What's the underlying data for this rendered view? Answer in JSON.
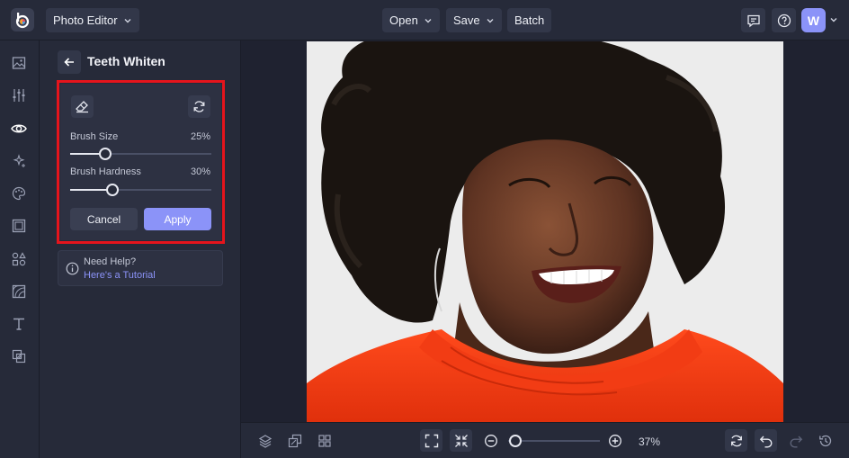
{
  "topbar": {
    "app_label": "Photo Editor",
    "open_label": "Open",
    "save_label": "Save",
    "batch_label": "Batch",
    "avatar_initial": "W"
  },
  "rail": {
    "icons": [
      "image-icon",
      "adjustments-icon",
      "eye-icon",
      "sparkle-icon",
      "palette-icon",
      "frame-icon",
      "shapes-icon",
      "texture-icon",
      "text-icon",
      "overlay-icon"
    ]
  },
  "panel": {
    "title": "Teeth Whiten",
    "brush_size_label": "Brush Size",
    "brush_size_value": "25%",
    "brush_size_level": 0.25,
    "brush_hardness_label": "Brush Hardness",
    "brush_hardness_value": "30%",
    "brush_hardness_level": 0.3,
    "cancel_label": "Cancel",
    "apply_label": "Apply",
    "help_title": "Need Help?",
    "help_link": "Here's a Tutorial"
  },
  "bottombar": {
    "zoom_value": "37%",
    "zoom_level": 0.37
  },
  "colors": {
    "accent": "#8b93f8",
    "highlight": "#e5141c",
    "background": "#1f2230",
    "panel": "#262a39"
  }
}
